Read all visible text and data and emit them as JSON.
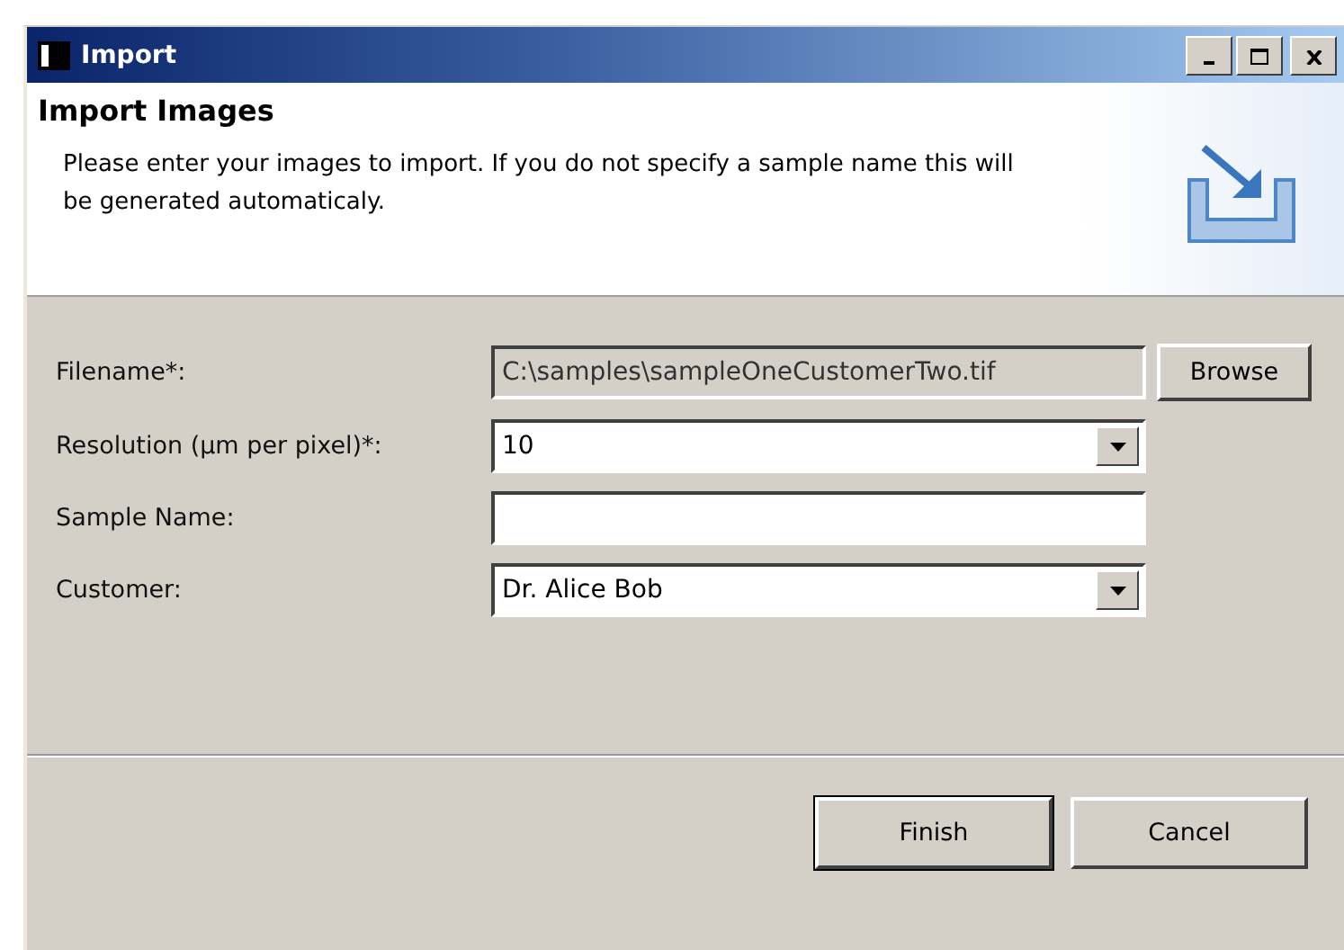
{
  "window": {
    "title": "Import"
  },
  "header": {
    "title": "Import Images",
    "description": "Please enter your images to import. If you do not specify a sample name this will be generated automaticaly."
  },
  "fields": [
    {
      "label": "Filename*:",
      "kind": "text",
      "value": "C:\\samples\\sampleOneCustomerTwo.tif",
      "disabled": true,
      "button": "Browse"
    },
    {
      "label": "Resolution (µm per pixel)*:",
      "kind": "combo",
      "value": "10",
      "disabled": false
    },
    {
      "label": "Sample Name:",
      "kind": "text",
      "disabled": false
    },
    {
      "label": "Customer:",
      "kind": "combo",
      "value": "Dr. Alice Bob",
      "disabled": false
    }
  ],
  "buttons": [
    {
      "label": "Finish",
      "default": true
    },
    {
      "label": "Cancel",
      "default": false
    }
  ]
}
